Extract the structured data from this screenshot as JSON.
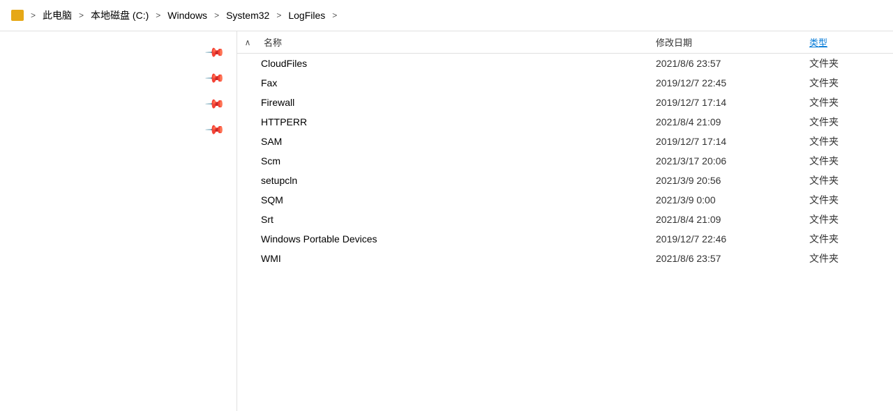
{
  "breadcrumb": {
    "items": [
      {
        "label": "此电脑",
        "icon": "folder"
      },
      {
        "label": "本地磁盘 (C:)",
        "icon": "disk"
      },
      {
        "label": "Windows"
      },
      {
        "label": "System32"
      },
      {
        "label": "LogFiles"
      }
    ],
    "separators": [
      ">",
      ">",
      ">",
      ">",
      ">"
    ]
  },
  "columns": {
    "name": "名称",
    "date": "修改日期",
    "type": "类型",
    "sort_arrow": "∧"
  },
  "pins": [
    "📌",
    "📌",
    "📌",
    "📌"
  ],
  "files": [
    {
      "name": "CloudFiles",
      "date": "2021/8/6 23:57",
      "type": "文件夹"
    },
    {
      "name": "Fax",
      "date": "2019/12/7 22:45",
      "type": "文件夹"
    },
    {
      "name": "Firewall",
      "date": "2019/12/7 17:14",
      "type": "文件夹"
    },
    {
      "name": "HTTPERR",
      "date": "2021/8/4 21:09",
      "type": "文件夹"
    },
    {
      "name": "SAM",
      "date": "2019/12/7 17:14",
      "type": "文件夹"
    },
    {
      "name": "Scm",
      "date": "2021/3/17 20:06",
      "type": "文件夹"
    },
    {
      "name": "setupcln",
      "date": "2021/3/9 20:56",
      "type": "文件夹"
    },
    {
      "name": "SQM",
      "date": "2021/3/9 0:00",
      "type": "文件夹"
    },
    {
      "name": "Srt",
      "date": "2021/8/4 21:09",
      "type": "文件夹"
    },
    {
      "name": "Windows Portable Devices",
      "date": "2019/12/7 22:46",
      "type": "文件夹"
    },
    {
      "name": "WMI",
      "date": "2021/8/6 23:57",
      "type": "文件夹"
    }
  ]
}
